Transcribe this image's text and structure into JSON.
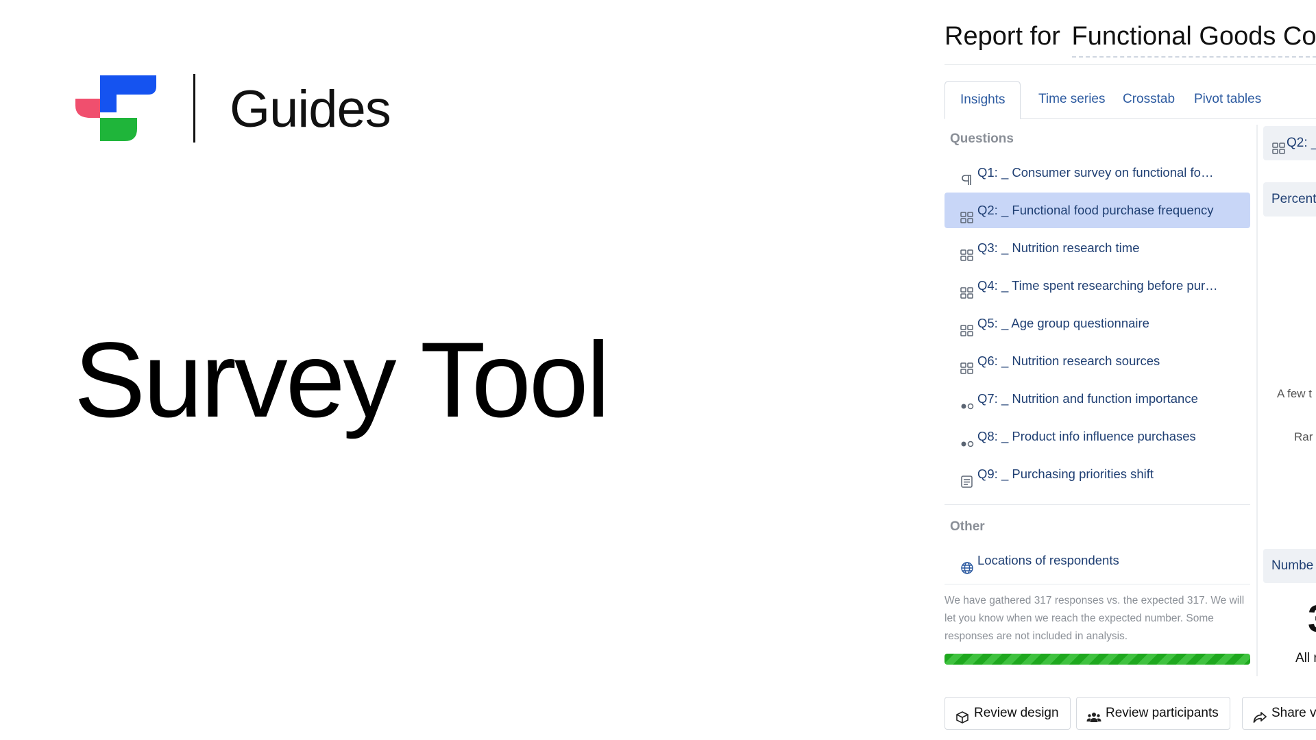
{
  "branding": {
    "section": "Guides",
    "title": "Survey Tool",
    "logo_colors": {
      "blue": "#1553f0",
      "pink": "#f04f6e",
      "green": "#1fb53a"
    }
  },
  "report": {
    "title_prefix": "Report for",
    "company": "Functional Goods Co"
  },
  "tabs": [
    {
      "label": "Insights",
      "active": true
    },
    {
      "label": "Time series",
      "active": false
    },
    {
      "label": "Crosstab",
      "active": false
    },
    {
      "label": "Pivot tables",
      "active": false
    }
  ],
  "questions_heading": "Questions",
  "questions": [
    {
      "icon": "paragraph-icon",
      "label": "Q1: _ Consumer survey on functional fo…",
      "selected": false
    },
    {
      "icon": "grid-icon",
      "label": "Q2: _ Functional food purchase frequency",
      "selected": true
    },
    {
      "icon": "grid-icon",
      "label": "Q3: _ Nutrition research time",
      "selected": false
    },
    {
      "icon": "grid-icon",
      "label": "Q4: _ Time spent researching before pur…",
      "selected": false
    },
    {
      "icon": "grid-icon",
      "label": "Q5: _ Age group questionnaire",
      "selected": false
    },
    {
      "icon": "grid-icon",
      "label": "Q6: _ Nutrition research sources",
      "selected": false
    },
    {
      "icon": "radio-icon",
      "label": "Q7: _ Nutrition and function importance",
      "selected": false
    },
    {
      "icon": "radio-icon",
      "label": "Q8: _ Product info influence purchases",
      "selected": false
    },
    {
      "icon": "list-icon",
      "label": "Q9: _ Purchasing priorities shift",
      "selected": false
    }
  ],
  "other_heading": "Other",
  "other_items": [
    {
      "icon": "globe-icon",
      "label": "Locations of respondents"
    }
  ],
  "responses_note": "We have gathered 317 responses vs. the expected 317. We will let you know when we reach the expected number. Some responses are not included in analysis.",
  "progress": {
    "gathered": 317,
    "expected": 317,
    "fraction": 1.0,
    "color": "#1ea81e"
  },
  "detail": {
    "question_tab": "Q2: _",
    "percent_tab": "Percent",
    "label_a_few": "A few t",
    "label_rare": "Rar",
    "number_tab": "Numbe",
    "big_number": "3",
    "all_label": "All r"
  },
  "buttons": [
    {
      "icon": "cube-icon",
      "label": "Review design"
    },
    {
      "icon": "users-icon",
      "label": "Review participants"
    },
    {
      "icon": "share-icon",
      "label": "Share v"
    }
  ]
}
